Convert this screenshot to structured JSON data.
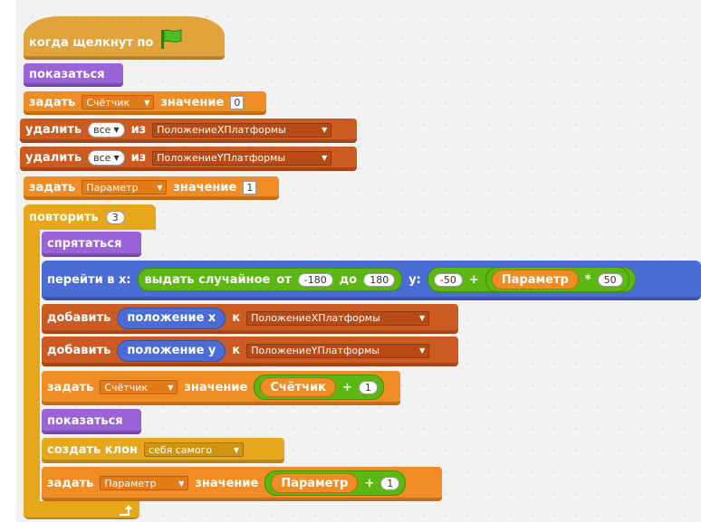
{
  "script": {
    "hat": {
      "label": "когда щелкнут по",
      "icon": "green-flag-icon"
    },
    "show1": "показаться",
    "set_counter": {
      "label": "задать",
      "var": "Счётчик",
      "value_label": "значение",
      "value": "0"
    },
    "delete_x": {
      "label": "удалить",
      "item": "все",
      "from": "из",
      "list": "ПоложениеXПлатформы"
    },
    "delete_y": {
      "label": "удалить",
      "item": "все",
      "from": "из",
      "list": "ПоложениеYПлатформы"
    },
    "set_param": {
      "label": "задать",
      "var": "Параметр",
      "value_label": "значение",
      "value": "1"
    },
    "repeat": {
      "label": "повторить",
      "count": "3"
    },
    "hide": "спрятаться",
    "goto": {
      "label": "перейти в х:",
      "random_label": "выдать случайное",
      "from": "от",
      "from_value": "-180",
      "to": "до",
      "to_value": "180",
      "y_label": "у:",
      "y_value": "-50",
      "plus": "+",
      "param": "Параметр",
      "times": "*",
      "times_value": "50"
    },
    "add_x": {
      "label": "добавить",
      "reporter": "положение х",
      "to": "к",
      "list": "ПоложениеXПлатформы"
    },
    "add_y": {
      "label": "добавить",
      "reporter": "положение у",
      "to": "к",
      "list": "ПоложениеYПлатформы"
    },
    "set_counter2": {
      "label": "задать",
      "var": "Счётчик",
      "value_label": "значение",
      "reporter": "Счётчик",
      "plus": "+",
      "value": "1"
    },
    "show2": "показаться",
    "clone": {
      "label": "создать клон",
      "target": "себя самого"
    },
    "set_param2": {
      "label": "задать",
      "var": "Параметр",
      "value_label": "значение",
      "reporter": "Параметр",
      "plus": "+",
      "value": "1"
    },
    "loop_icon": "loop-arrow-icon"
  },
  "colors": {
    "events": "#e2a33a",
    "looks": "#9a63d8",
    "variables": "#ef8c24",
    "lists": "#cc5b22",
    "control": "#e6a81a",
    "motion": "#4a6cd4",
    "operators": "#5cb712"
  }
}
